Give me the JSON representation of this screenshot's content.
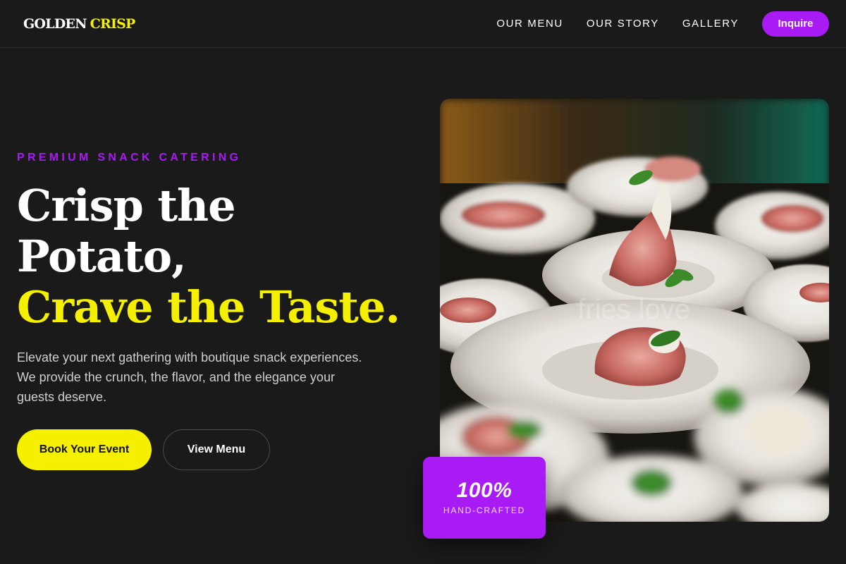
{
  "brand": {
    "word1": "GOLDEN",
    "word2": "CRISP"
  },
  "nav": {
    "links": [
      "OUR MENU",
      "OUR STORY",
      "GALLERY"
    ],
    "cta": "Inquire"
  },
  "hero": {
    "eyebrow": "PREMIUM SNACK CATERING",
    "headline_line1": "Crisp the",
    "headline_line2": "Potato,",
    "headline_line3": "Crave the Taste.",
    "description": "Elevate your next gathering with boutique snack experiences. We provide the crunch, the flavor, and the elegance your guests deserve.",
    "primary_button": "Book Your Event",
    "secondary_button": "View Menu"
  },
  "image": {
    "subject": "plated prosciutto appetizers with micro greens on white dishes",
    "watermark": "fries love"
  },
  "badge": {
    "value": "100%",
    "label": "HAND-CRAFTED"
  },
  "colors": {
    "background": "#1a1a1a",
    "accent_yellow": "#f5f000",
    "accent_purple": "#a81bf5"
  }
}
